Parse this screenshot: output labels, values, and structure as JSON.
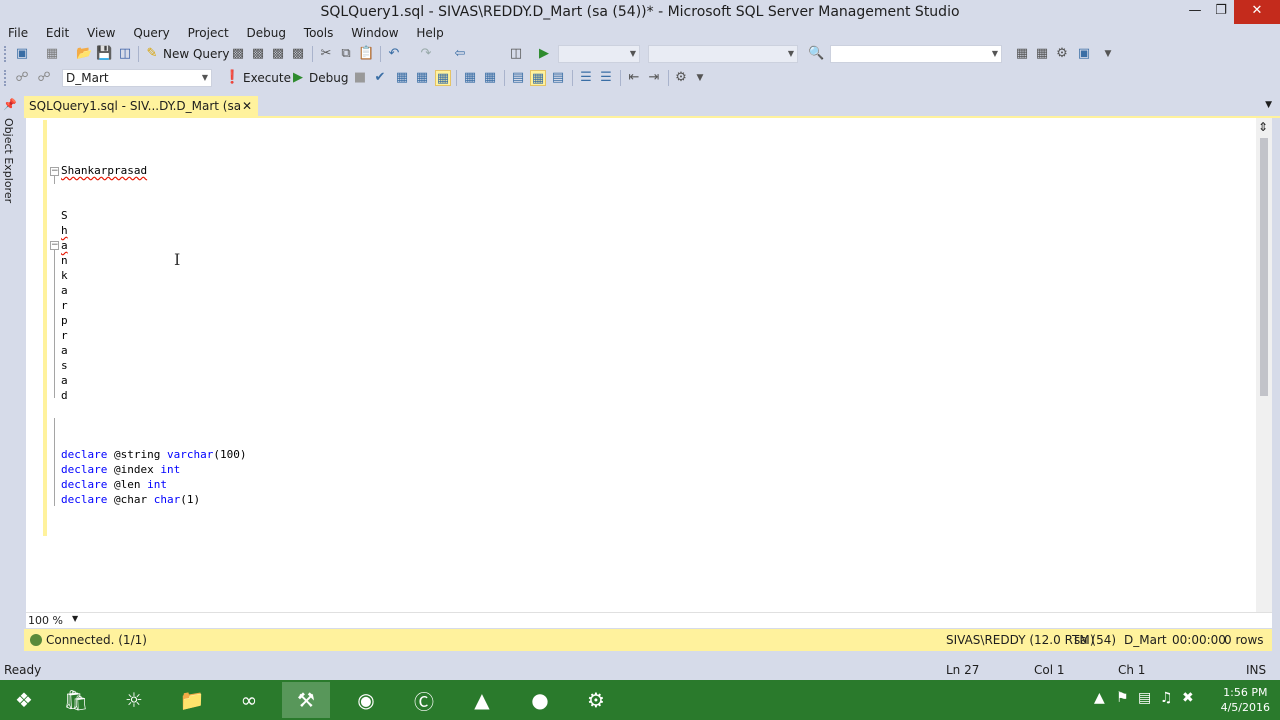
{
  "window": {
    "title": "SQLQuery1.sql - SIVAS\\REDDY.D_Mart (sa (54))* - Microsoft SQL Server Management Studio"
  },
  "menu": [
    "File",
    "Edit",
    "View",
    "Query",
    "Project",
    "Debug",
    "Tools",
    "Window",
    "Help"
  ],
  "toolbar": {
    "new_query_label": "New Query",
    "database_value": "D_Mart",
    "execute_label": "Execute",
    "debug_label": "Debug"
  },
  "side_panel": {
    "object_explorer_label": "Object Explorer"
  },
  "doc_tab": {
    "label": "SQLQuery1.sql - SIV...DY.D_Mart (sa (54))*"
  },
  "editor": {
    "name_line": "Shankarprasad",
    "letters": [
      "S",
      "h",
      "a",
      "n",
      "k",
      "a",
      "r",
      "p",
      "r",
      "a",
      "s",
      "a",
      "d"
    ],
    "declares": [
      {
        "keyword": "declare",
        "var": "@string",
        "type": "varchar",
        "suffix": "(100)"
      },
      {
        "keyword": "declare",
        "var": "@index",
        "type": "int",
        "suffix": ""
      },
      {
        "keyword": "declare",
        "var": "@len",
        "type": "int",
        "suffix": ""
      },
      {
        "keyword": "declare",
        "var": "@char",
        "type": "char",
        "suffix": "(1)"
      }
    ]
  },
  "zoom": "100 %",
  "query_status": {
    "connection": "Connected. (1/1)",
    "server": "SIVAS\\REDDY (12.0 RTM)",
    "user": "sa (54)",
    "database": "D_Mart",
    "elapsed": "00:00:00",
    "rows": "0 rows"
  },
  "status_bar": {
    "state": "Ready",
    "line": "Ln 27",
    "col": "Col 1",
    "ch": "Ch 1",
    "mode": "INS"
  },
  "clock": {
    "time": "1:56 PM",
    "date": "4/5/2016"
  },
  "colors": {
    "chrome": "#d6dbe9",
    "accent_yellow": "#fff29d",
    "keyword_blue": "#0000ff",
    "close_red": "#c42b1c",
    "taskbar_green": "#2a7a2c"
  }
}
